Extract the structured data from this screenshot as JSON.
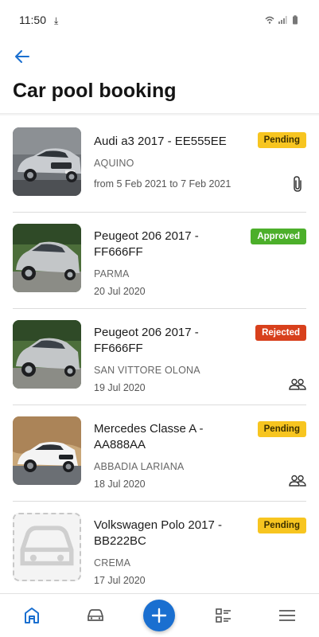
{
  "status_bar": {
    "time": "11:50"
  },
  "header": {
    "title": "Car pool booking"
  },
  "colors": {
    "accent": "#1a6fd0",
    "pending": "#f7c520",
    "approved": "#4caf2a",
    "rejected": "#d8401c"
  },
  "bookings": [
    {
      "title": "Audi a3 2017 - EE555EE",
      "location": "AQUINO",
      "date": "from 5 Feb 2021 to 7 Feb 2021",
      "status": "Pending",
      "icon": "paperclip-icon"
    },
    {
      "title": "Peugeot 206 2017 - FF666FF",
      "location": "PARMA",
      "date": "20 Jul 2020",
      "status": "Approved",
      "icon": ""
    },
    {
      "title": "Peugeot 206 2017 - FF666FF",
      "location": "SAN VITTORE OLONA",
      "date": "19 Jul 2020",
      "status": "Rejected",
      "icon": "people-icon"
    },
    {
      "title": "Mercedes Classe A - AA888AA",
      "location": "ABBADIA LARIANA",
      "date": "18 Jul 2020",
      "status": "Pending",
      "icon": "people-icon"
    },
    {
      "title": "Volkswagen Polo 2017 - BB222BC",
      "location": "CREMA",
      "date": "17 Jul 2020",
      "status": "Pending",
      "icon": ""
    }
  ],
  "bottom_nav": [
    "home-icon",
    "car-icon",
    "add-icon",
    "checklist-icon",
    "menu-icon"
  ]
}
